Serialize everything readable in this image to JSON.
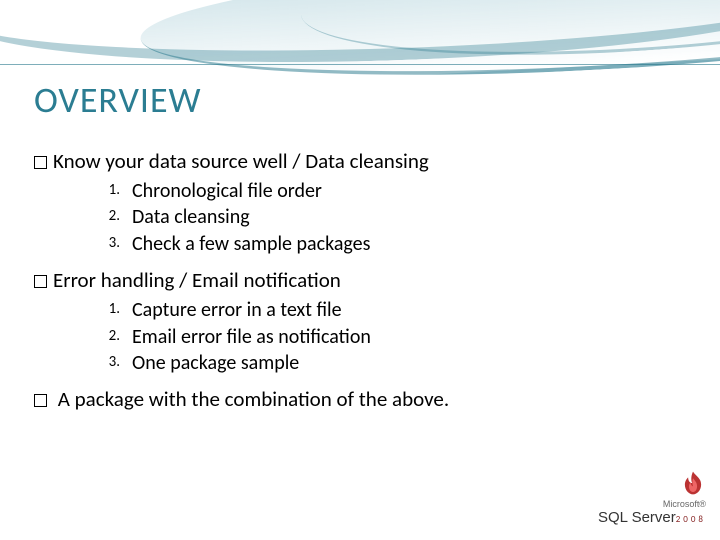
{
  "title": "OVERVIEW",
  "sections": [
    {
      "heading": "Know your data source well / Data cleansing",
      "items": [
        "Chronological file order",
        "Data cleansing",
        "Check a few sample packages"
      ]
    },
    {
      "heading": "Error handling / Email notification",
      "items": [
        "Capture error in a text file",
        "Email error file as notification",
        "One package sample"
      ]
    }
  ],
  "final_point": " A package with the combination of the above.",
  "logo": {
    "brand": "Microsoft®",
    "product": "SQL Server",
    "year": "2008"
  }
}
